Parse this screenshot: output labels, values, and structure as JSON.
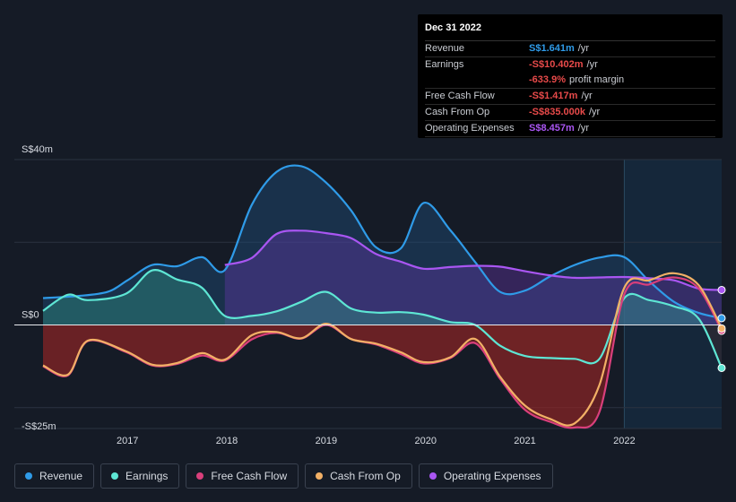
{
  "chart_data": {
    "type": "area",
    "currency_prefix": "S$",
    "y_axis_labels": [
      "S$40m",
      "S$0",
      "-S$25m"
    ],
    "ylim": [
      -25,
      40
    ],
    "x_ticks": [
      "2017",
      "2018",
      "2019",
      "2020",
      "2021",
      "2022"
    ],
    "x_tick_values": [
      2017,
      2018,
      2019,
      2020,
      2021,
      2022
    ],
    "xlim": [
      2016.15,
      2022.98
    ],
    "forecast_start": 2022.0,
    "series": [
      {
        "name": "Revenue",
        "key": "revenue",
        "color": "#2f9be8",
        "x": [
          2016.15,
          2016.5,
          2016.8,
          2017.0,
          2017.25,
          2017.5,
          2017.75,
          2017.98,
          2018.25,
          2018.5,
          2018.75,
          2019.0,
          2019.25,
          2019.5,
          2019.75,
          2019.98,
          2020.25,
          2020.5,
          2020.75,
          2021.0,
          2021.25,
          2021.5,
          2021.75,
          2022.0,
          2022.25,
          2022.5,
          2022.75,
          2022.98
        ],
        "values": [
          6.5,
          7.0,
          8.0,
          10.8,
          14.5,
          14.2,
          16.4,
          13.3,
          29.0,
          37.0,
          38.4,
          34.4,
          27.7,
          18.8,
          18.5,
          29.5,
          22.9,
          15.2,
          8.0,
          8.3,
          11.7,
          14.5,
          16.3,
          16.4,
          10.6,
          5.6,
          2.9,
          1.641
        ]
      },
      {
        "name": "Earnings",
        "key": "earnings",
        "color": "#5ee6d4",
        "x": [
          2016.15,
          2016.4,
          2016.6,
          2016.98,
          2017.25,
          2017.5,
          2017.75,
          2017.98,
          2018.25,
          2018.5,
          2018.75,
          2019.0,
          2019.25,
          2019.5,
          2019.75,
          2019.98,
          2020.25,
          2020.5,
          2020.75,
          2021.0,
          2021.25,
          2021.5,
          2021.75,
          2022.0,
          2022.25,
          2022.5,
          2022.75,
          2022.98
        ],
        "values": [
          3.4,
          7.3,
          6.0,
          7.5,
          13.2,
          11.0,
          9.0,
          2.2,
          2.2,
          3.3,
          5.6,
          8.0,
          4.0,
          3.0,
          3.1,
          2.5,
          0.7,
          0.0,
          -5.0,
          -7.5,
          -8.0,
          -8.2,
          -8.2,
          6.5,
          6.0,
          4.5,
          1.5,
          -10.402
        ]
      },
      {
        "name": "Free Cash Flow",
        "key": "fcf",
        "color": "#d93f7b",
        "x": [
          2016.15,
          2016.4,
          2016.6,
          2016.98,
          2017.25,
          2017.5,
          2017.75,
          2017.98,
          2018.25,
          2018.5,
          2018.75,
          2019.0,
          2019.25,
          2019.5,
          2019.75,
          2019.98,
          2020.25,
          2020.5,
          2020.75,
          2021.0,
          2021.25,
          2021.5,
          2021.75,
          2022.0,
          2022.25,
          2022.5,
          2022.75,
          2022.98
        ],
        "values": [
          -10.0,
          -12.2,
          -3.9,
          -6.5,
          -9.8,
          -9.4,
          -7.4,
          -8.6,
          -3.5,
          -1.9,
          -3.3,
          0.0,
          -3.4,
          -4.7,
          -7.0,
          -9.3,
          -8.0,
          -4.4,
          -13.0,
          -20.5,
          -23.4,
          -24.8,
          -21.0,
          7.4,
          9.8,
          11.5,
          8.8,
          -1.417
        ]
      },
      {
        "name": "Cash From Op",
        "key": "cfo",
        "color": "#f2b066",
        "x": [
          2016.15,
          2016.4,
          2016.6,
          2016.98,
          2017.25,
          2017.5,
          2017.75,
          2017.98,
          2018.25,
          2018.5,
          2018.75,
          2019.0,
          2019.25,
          2019.5,
          2019.75,
          2019.98,
          2020.25,
          2020.5,
          2020.75,
          2021.0,
          2021.25,
          2021.5,
          2021.75,
          2022.0,
          2022.25,
          2022.5,
          2022.75,
          2022.98
        ],
        "values": [
          -9.8,
          -12.0,
          -3.8,
          -6.3,
          -9.6,
          -9.2,
          -6.8,
          -8.4,
          -2.5,
          -1.7,
          -3.2,
          0.3,
          -3.4,
          -4.5,
          -6.6,
          -9.0,
          -7.8,
          -3.4,
          -12.5,
          -19.5,
          -22.7,
          -23.8,
          -14.5,
          9.0,
          10.8,
          12.5,
          9.6,
          -0.835
        ]
      },
      {
        "name": "Operating Expenses",
        "key": "opex",
        "color": "#a956f2",
        "x": [
          2017.98,
          2018.25,
          2018.5,
          2018.75,
          2019.0,
          2019.25,
          2019.5,
          2019.75,
          2019.98,
          2020.25,
          2020.5,
          2020.75,
          2021.0,
          2021.25,
          2021.5,
          2021.75,
          2022.0,
          2022.25,
          2022.5,
          2022.75,
          2022.98
        ],
        "values": [
          14.5,
          16.2,
          22.0,
          22.8,
          22.2,
          21.0,
          17.2,
          15.3,
          13.6,
          14.0,
          14.3,
          14.1,
          13.0,
          12.0,
          11.4,
          11.5,
          11.6,
          11.3,
          10.8,
          8.8,
          8.457
        ]
      }
    ]
  },
  "tooltip": {
    "date": "Dec 31 2022",
    "rows": [
      {
        "label": "Revenue",
        "value": "S$1.641m",
        "unit": "/yr",
        "color": "#2f9be8"
      },
      {
        "label": "Earnings",
        "value": "-S$10.402m",
        "unit": "/yr",
        "color": "#e84a4a"
      },
      {
        "label": "",
        "value": "-633.9%",
        "unit": "profit margin",
        "color": "#e84a4a"
      },
      {
        "label": "Free Cash Flow",
        "value": "-S$1.417m",
        "unit": "/yr",
        "color": "#e84a4a"
      },
      {
        "label": "Cash From Op",
        "value": "-S$835.000k",
        "unit": "/yr",
        "color": "#e84a4a"
      },
      {
        "label": "Operating Expenses",
        "value": "S$8.457m",
        "unit": "/yr",
        "color": "#a956f2"
      }
    ]
  },
  "legend": {
    "items": [
      {
        "label": "Revenue",
        "color": "#2f9be8"
      },
      {
        "label": "Earnings",
        "color": "#5ee6d4"
      },
      {
        "label": "Free Cash Flow",
        "color": "#d93f7b"
      },
      {
        "label": "Cash From Op",
        "color": "#f2b066"
      },
      {
        "label": "Operating Expenses",
        "color": "#a956f2"
      }
    ]
  }
}
